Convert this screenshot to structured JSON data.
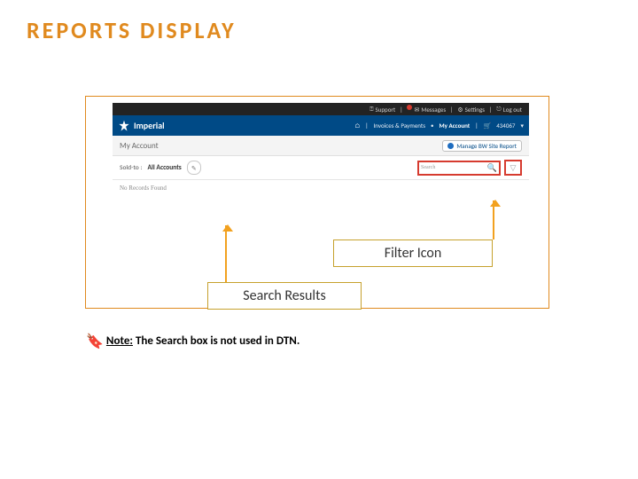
{
  "title": "REPORTS DISPLAY",
  "topbar": {
    "support": "Support",
    "messages": "Messages",
    "msg_badge": "1",
    "settings": "Settings",
    "logout": "Log out"
  },
  "navbar": {
    "brand": "Imperial",
    "invoices": "Invoices & Payments",
    "myaccount": "My Account",
    "acct_no": "434067"
  },
  "subheader": {
    "section": "My Account",
    "manage": "Manage BW Site Report"
  },
  "filterrow": {
    "soldto_label": "Sold-to :",
    "soldto_value": "All Accounts",
    "search_placeholder": "Search",
    "filter_glyph": "▽",
    "mag_glyph": "🔍"
  },
  "results": {
    "none": "No Records Found"
  },
  "callouts": {
    "filter": "Filter Icon",
    "results": "Search Results"
  },
  "note": {
    "label": "Note:",
    "text": " The Search box is not used in DTN."
  }
}
